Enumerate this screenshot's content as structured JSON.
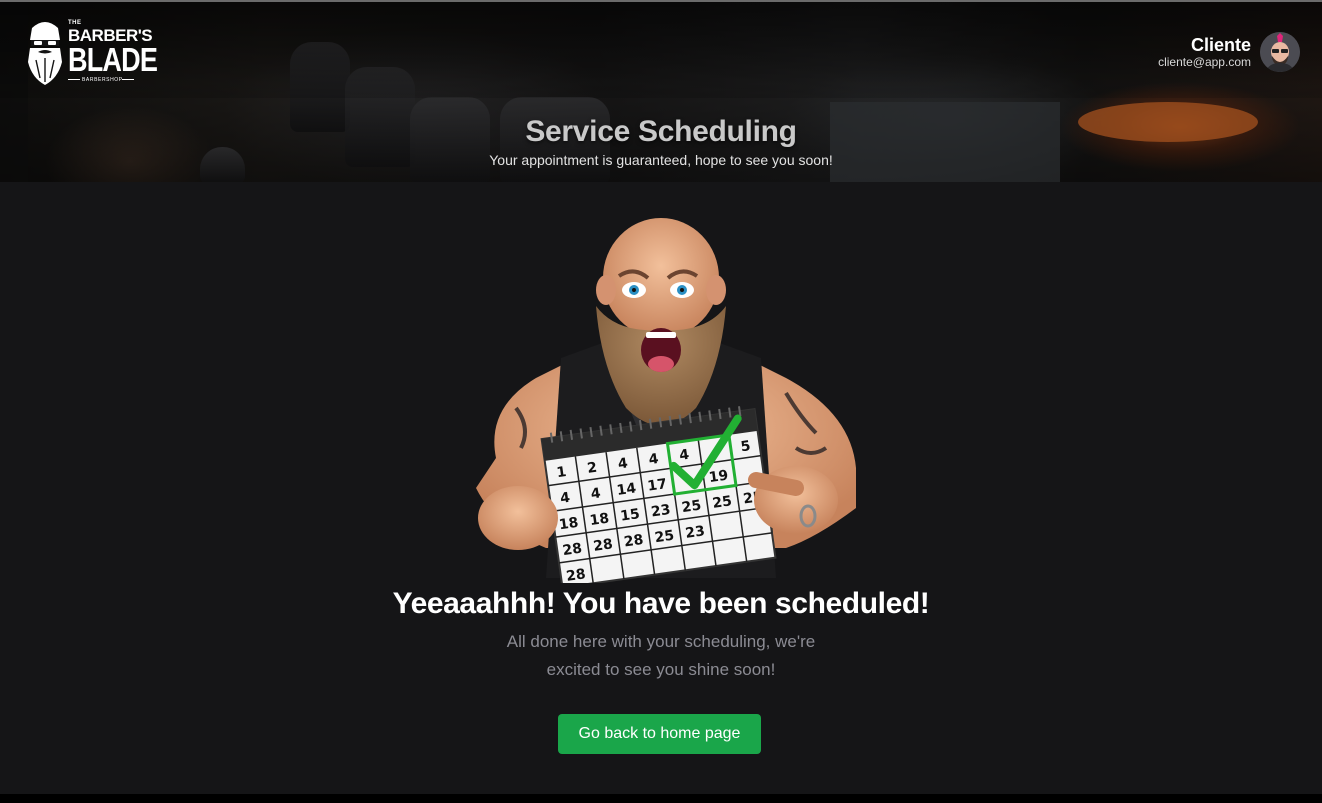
{
  "header": {
    "logo": {
      "line1": "THE",
      "line2": "BARBER'S",
      "line3": "BLADE",
      "line4": "BARBERSHOP"
    },
    "user": {
      "name": "Cliente",
      "email": "cliente@app.com",
      "avatar_icon": "user-avatar-icon"
    },
    "title": "Service Scheduling",
    "subtitle": "Your appointment is guaranteed, hope to see you soon!"
  },
  "main": {
    "illustration": {
      "icon": "excited-man-with-calendar-illustration",
      "calendar_days": [
        "1",
        "2",
        "4",
        "4",
        "4",
        "4",
        "17",
        "19",
        "4",
        "4",
        "14",
        "15",
        "23",
        "25",
        "25",
        "25",
        "18",
        "18",
        "15",
        "28",
        "25",
        "23",
        "28",
        "28",
        "28"
      ],
      "calendar_header_days": [
        "5"
      ]
    },
    "headline": "Yeeaaahhh! You have been scheduled!",
    "message": "All done here with your scheduling, we're excited to see you shine soon!",
    "home_button": "Go back to home page"
  },
  "colors": {
    "background": "#151517",
    "button": "#1aa64a",
    "muted_text": "#8b8b93",
    "check": "#22b033"
  }
}
